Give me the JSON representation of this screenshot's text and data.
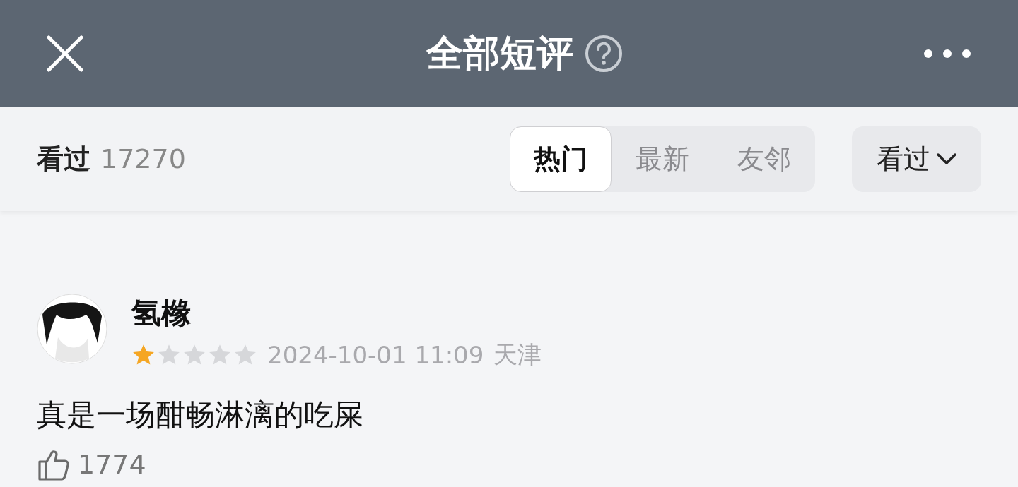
{
  "header": {
    "title": "全部短评"
  },
  "filter_bar": {
    "label": "看过",
    "count": "17270",
    "tabs": [
      {
        "label": "热门",
        "selected": true
      },
      {
        "label": "最新",
        "selected": false
      },
      {
        "label": "友邻",
        "selected": false
      }
    ],
    "dropdown": {
      "label": "看过"
    }
  },
  "comments": [
    {
      "user": "氢橼",
      "stars": 1,
      "time": "2024-10-01 11:09",
      "location": "天津",
      "text": "真是一场酣畅淋漓的吃屎",
      "likes": "1774"
    }
  ]
}
